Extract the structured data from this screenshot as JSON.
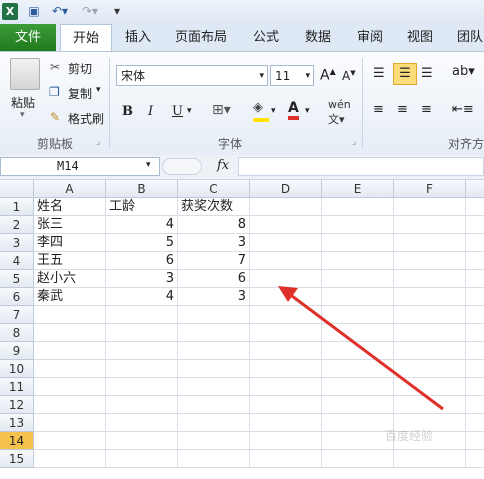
{
  "tabs": [
    "文件",
    "开始",
    "插入",
    "页面布局",
    "公式",
    "数据",
    "审阅",
    "视图",
    "团队"
  ],
  "clipboard": {
    "paste": "粘贴",
    "cut": "剪切",
    "copy": "复制",
    "format_painter": "格式刷",
    "group": "剪贴板"
  },
  "font": {
    "name": "宋体",
    "size": "11",
    "bold": "B",
    "italic": "I",
    "underline": "U",
    "color_letter": "A",
    "group": "字体"
  },
  "alignment": {
    "group": "对齐方"
  },
  "accent": {
    "green": "#217346",
    "highlight_yellow": "#f6c24e",
    "arrow_red": "#e0302a"
  },
  "formula_bar": {
    "cell_ref": "M14",
    "fx": "fx"
  },
  "columns": [
    "A",
    "B",
    "C",
    "D",
    "E",
    "F"
  ],
  "rows": [
    "1",
    "2",
    "3",
    "4",
    "5",
    "6",
    "7",
    "8",
    "9",
    "10",
    "11",
    "12",
    "13",
    "14",
    "15"
  ],
  "selected_row": "14",
  "table": {
    "headers": [
      "姓名",
      "工龄",
      "获奖次数"
    ],
    "data": [
      [
        "张三",
        "4",
        "8"
      ],
      [
        "李四",
        "5",
        "3"
      ],
      [
        "王五",
        "6",
        "7"
      ],
      [
        "赵小六",
        "3",
        "6"
      ],
      [
        "秦武",
        "4",
        "3"
      ]
    ]
  },
  "watermark": "百度经验"
}
